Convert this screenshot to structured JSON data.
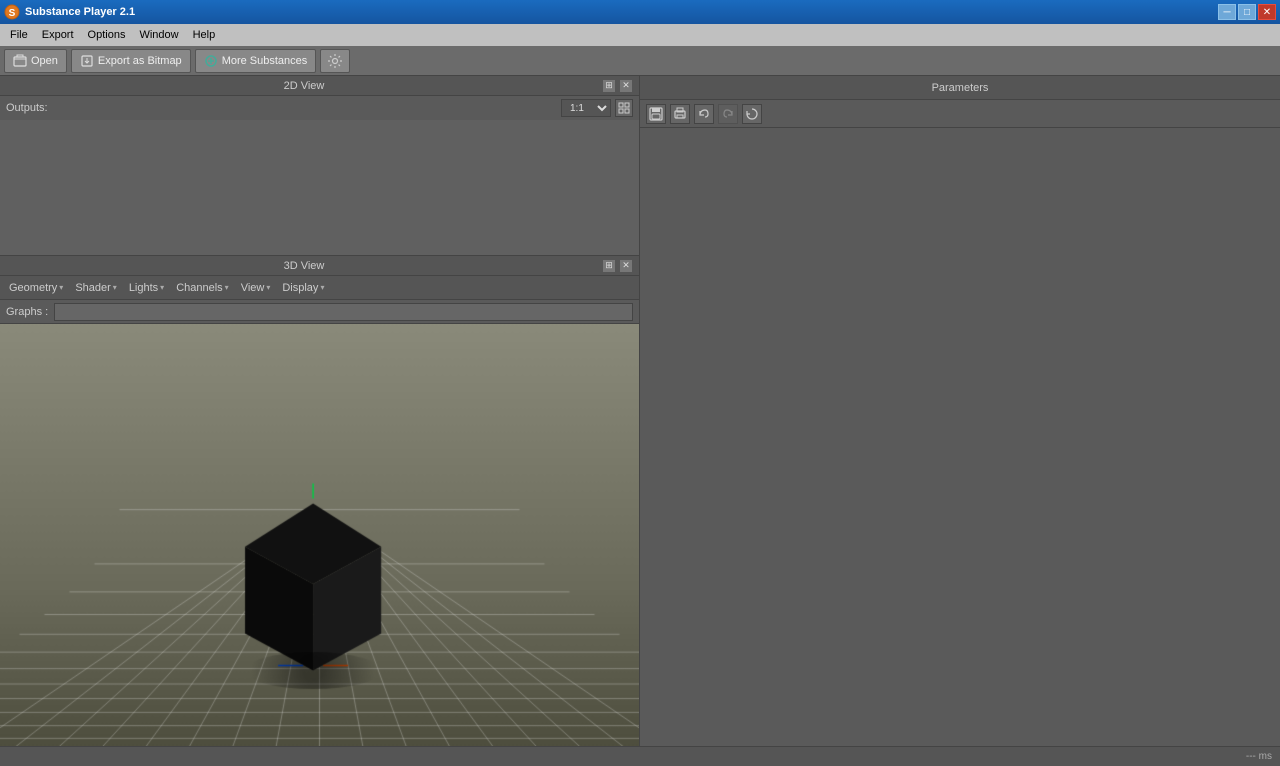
{
  "titlebar": {
    "icon": "●",
    "title": "Substance Player 2.1",
    "minimize_label": "─",
    "restore_label": "□",
    "close_label": "✕"
  },
  "menubar": {
    "items": [
      {
        "label": "File"
      },
      {
        "label": "Export"
      },
      {
        "label": "Options"
      },
      {
        "label": "Window"
      },
      {
        "label": "Help"
      }
    ]
  },
  "toolbar": {
    "open_label": "Open",
    "export_label": "Export as Bitmap",
    "substances_label": "More Substances",
    "settings_label": "⚙"
  },
  "view2d": {
    "title": "2D View",
    "outputs_label": "Outputs:",
    "zoom_value": "1:1",
    "pin_label": "📌",
    "close_label": "✕"
  },
  "view3d": {
    "title": "3D View",
    "pin_label": "📌",
    "close_label": "✕",
    "menus": [
      {
        "label": "Geometry"
      },
      {
        "label": "Shader"
      },
      {
        "label": "Lights"
      },
      {
        "label": "Channels"
      },
      {
        "label": "View"
      },
      {
        "label": "Display"
      }
    ],
    "graphs_label": "Graphs :"
  },
  "params": {
    "title": "Parameters",
    "icons": [
      "💾",
      "🖨",
      "↩",
      "↪",
      "🔄"
    ]
  },
  "statusbar": {
    "text": "--- ms"
  }
}
